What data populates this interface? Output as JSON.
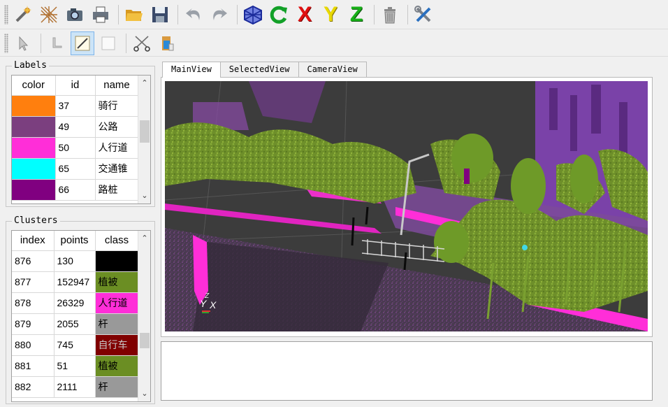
{
  "toolbar_main": {
    "buttons": [
      {
        "name": "magic-wand-icon"
      },
      {
        "name": "net-select-icon"
      },
      {
        "name": "camera-icon"
      },
      {
        "name": "print-icon"
      },
      {
        "name": "open-folder-icon"
      },
      {
        "name": "save-icon"
      },
      {
        "name": "undo-icon"
      },
      {
        "name": "redo-icon"
      },
      {
        "name": "cube-view-icon"
      },
      {
        "name": "refresh-icon"
      },
      {
        "name": "x-axis-icon",
        "label": "X",
        "color": "#e01010"
      },
      {
        "name": "y-axis-icon",
        "label": "Y",
        "color": "#e8d800"
      },
      {
        "name": "z-axis-icon",
        "label": "Z",
        "color": "#18b018"
      },
      {
        "name": "trash-icon"
      },
      {
        "name": "tools-icon"
      }
    ]
  },
  "toolbar_edit": {
    "buttons": [
      {
        "name": "pointer-icon"
      },
      {
        "name": "foot-select-icon"
      },
      {
        "name": "draw-line-icon",
        "active": true
      },
      {
        "name": "rectangle-icon"
      },
      {
        "name": "scissors-icon"
      },
      {
        "name": "paint-bucket-icon"
      }
    ]
  },
  "labels": {
    "title": "Labels",
    "columns": [
      "color",
      "id",
      "name"
    ],
    "rows": [
      {
        "color": "#ff7f0e",
        "id": "37",
        "name": "骑行"
      },
      {
        "color": "#7b3f7f",
        "id": "49",
        "name": "公路"
      },
      {
        "color": "#ff2ed8",
        "id": "50",
        "name": "人行道"
      },
      {
        "color": "#00ffff",
        "id": "65",
        "name": "交通锥"
      },
      {
        "color": "#800080",
        "id": "66",
        "name": "路桩"
      }
    ]
  },
  "clusters": {
    "title": "Clusters",
    "columns": [
      "index",
      "points",
      "class"
    ],
    "rows": [
      {
        "index": "876",
        "points": "130",
        "class": "",
        "color": "#000000"
      },
      {
        "index": "877",
        "points": "152947",
        "class": "植被",
        "color": "#6b8e23"
      },
      {
        "index": "878",
        "points": "26329",
        "class": "人行道",
        "color": "#ff2ed8"
      },
      {
        "index": "879",
        "points": "2055",
        "class": "杆",
        "color": "#999999"
      },
      {
        "index": "880",
        "points": "745",
        "class": "自行车",
        "color": "#800000"
      },
      {
        "index": "881",
        "points": "51",
        "class": "植被",
        "color": "#6b8e23"
      },
      {
        "index": "882",
        "points": "2111",
        "class": "杆",
        "color": "#999999"
      }
    ]
  },
  "tabs": [
    "MainView",
    "SelectedView",
    "CameraView"
  ],
  "active_tab": "MainView",
  "viewport": {
    "axis_y": "Y",
    "axis_x": "X",
    "axis_z": "Z"
  },
  "console": {
    "text": ""
  }
}
